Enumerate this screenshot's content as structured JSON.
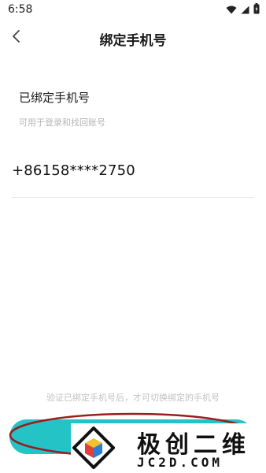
{
  "status_bar": {
    "time": "6:58",
    "icons": [
      "wifi-icon",
      "signal-icon",
      "battery-icon"
    ]
  },
  "header": {
    "back_icon": "chevron-left-icon",
    "title": "绑定手机号"
  },
  "content": {
    "section_title": "已绑定手机号",
    "section_subtitle": "可用于登录和找回账号",
    "phone_number": "+86158****2750"
  },
  "footer": {
    "hint": "验证已绑定手机号后，才可切换绑定的手机号",
    "button_color": "#23c3c6",
    "annotation_color": "#9b1d1d"
  },
  "watermark": {
    "name": "极创二维",
    "domain": "JC2D.COM"
  },
  "colors": {
    "accent": "#23c3c6",
    "muted_text": "#b5b5b5"
  }
}
